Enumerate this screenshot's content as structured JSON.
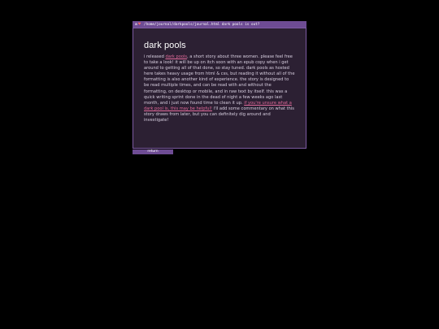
{
  "titlebar": {
    "icons": [
      "mail-icon",
      "heart-icon"
    ],
    "path": "/home/journal/darkpools/journal.html",
    "question": "dark pools is out?"
  },
  "post": {
    "title": "dark pools",
    "p_before_link1": "i released ",
    "link1": "dark pools",
    "p_after_link1": ", a short story about three women. please feel free to take a look! it will be up on itch soon with an epub copy when i get around to getting all of that done, so stay tuned. dark pools as hosted here takes heavy usage from html & css, but reading it without all of the formatting is also another kind of experience. the story is designed to be read multiple times, and can be read with and without the formatting, on desktop or mobile, and in raw text by itself. this was a quick writing sprint done in the dead of night a few weeks ago last month, and i just now found time to clean it up. ",
    "link2": "if you're unsure what a dark pool is, this may be helpful!",
    "p_after_link2": " i'll add some commentary on what this story draws from later, but you can definitely dig around and investigate!"
  },
  "footer": {
    "return_label": "return"
  },
  "colors": {
    "background": "#000000",
    "window_bg": "#2c2033",
    "accent": "#6e4c94",
    "border": "#7c5aa3",
    "link": "#e06a9a"
  }
}
